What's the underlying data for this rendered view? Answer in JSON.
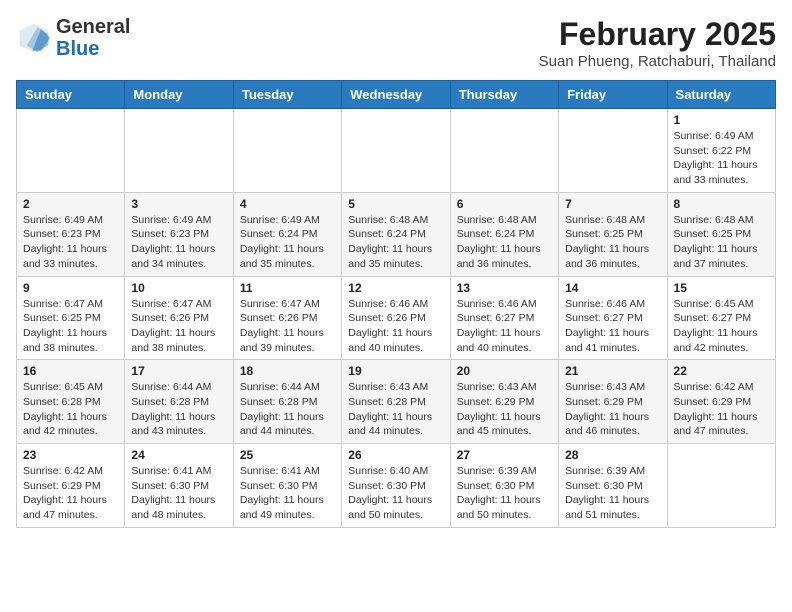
{
  "logo": {
    "general": "General",
    "blue": "Blue"
  },
  "header": {
    "month": "February 2025",
    "location": "Suan Phueng, Ratchaburi, Thailand"
  },
  "weekdays": [
    "Sunday",
    "Monday",
    "Tuesday",
    "Wednesday",
    "Thursday",
    "Friday",
    "Saturday"
  ],
  "weeks": [
    [
      null,
      null,
      null,
      null,
      null,
      null,
      {
        "day": "1",
        "info": "Sunrise: 6:49 AM\nSunset: 6:22 PM\nDaylight: 11 hours\nand 33 minutes."
      }
    ],
    [
      {
        "day": "2",
        "info": "Sunrise: 6:49 AM\nSunset: 6:23 PM\nDaylight: 11 hours\nand 33 minutes."
      },
      {
        "day": "3",
        "info": "Sunrise: 6:49 AM\nSunset: 6:23 PM\nDaylight: 11 hours\nand 34 minutes."
      },
      {
        "day": "4",
        "info": "Sunrise: 6:49 AM\nSunset: 6:24 PM\nDaylight: 11 hours\nand 35 minutes."
      },
      {
        "day": "5",
        "info": "Sunrise: 6:48 AM\nSunset: 6:24 PM\nDaylight: 11 hours\nand 35 minutes."
      },
      {
        "day": "6",
        "info": "Sunrise: 6:48 AM\nSunset: 6:24 PM\nDaylight: 11 hours\nand 36 minutes."
      },
      {
        "day": "7",
        "info": "Sunrise: 6:48 AM\nSunset: 6:25 PM\nDaylight: 11 hours\nand 36 minutes."
      },
      {
        "day": "8",
        "info": "Sunrise: 6:48 AM\nSunset: 6:25 PM\nDaylight: 11 hours\nand 37 minutes."
      }
    ],
    [
      {
        "day": "9",
        "info": "Sunrise: 6:47 AM\nSunset: 6:25 PM\nDaylight: 11 hours\nand 38 minutes."
      },
      {
        "day": "10",
        "info": "Sunrise: 6:47 AM\nSunset: 6:26 PM\nDaylight: 11 hours\nand 38 minutes."
      },
      {
        "day": "11",
        "info": "Sunrise: 6:47 AM\nSunset: 6:26 PM\nDaylight: 11 hours\nand 39 minutes."
      },
      {
        "day": "12",
        "info": "Sunrise: 6:46 AM\nSunset: 6:26 PM\nDaylight: 11 hours\nand 40 minutes."
      },
      {
        "day": "13",
        "info": "Sunrise: 6:46 AM\nSunset: 6:27 PM\nDaylight: 11 hours\nand 40 minutes."
      },
      {
        "day": "14",
        "info": "Sunrise: 6:46 AM\nSunset: 6:27 PM\nDaylight: 11 hours\nand 41 minutes."
      },
      {
        "day": "15",
        "info": "Sunrise: 6:45 AM\nSunset: 6:27 PM\nDaylight: 11 hours\nand 42 minutes."
      }
    ],
    [
      {
        "day": "16",
        "info": "Sunrise: 6:45 AM\nSunset: 6:28 PM\nDaylight: 11 hours\nand 42 minutes."
      },
      {
        "day": "17",
        "info": "Sunrise: 6:44 AM\nSunset: 6:28 PM\nDaylight: 11 hours\nand 43 minutes."
      },
      {
        "day": "18",
        "info": "Sunrise: 6:44 AM\nSunset: 6:28 PM\nDaylight: 11 hours\nand 44 minutes."
      },
      {
        "day": "19",
        "info": "Sunrise: 6:43 AM\nSunset: 6:28 PM\nDaylight: 11 hours\nand 44 minutes."
      },
      {
        "day": "20",
        "info": "Sunrise: 6:43 AM\nSunset: 6:29 PM\nDaylight: 11 hours\nand 45 minutes."
      },
      {
        "day": "21",
        "info": "Sunrise: 6:43 AM\nSunset: 6:29 PM\nDaylight: 11 hours\nand 46 minutes."
      },
      {
        "day": "22",
        "info": "Sunrise: 6:42 AM\nSunset: 6:29 PM\nDaylight: 11 hours\nand 47 minutes."
      }
    ],
    [
      {
        "day": "23",
        "info": "Sunrise: 6:42 AM\nSunset: 6:29 PM\nDaylight: 11 hours\nand 47 minutes."
      },
      {
        "day": "24",
        "info": "Sunrise: 6:41 AM\nSunset: 6:30 PM\nDaylight: 11 hours\nand 48 minutes."
      },
      {
        "day": "25",
        "info": "Sunrise: 6:41 AM\nSunset: 6:30 PM\nDaylight: 11 hours\nand 49 minutes."
      },
      {
        "day": "26",
        "info": "Sunrise: 6:40 AM\nSunset: 6:30 PM\nDaylight: 11 hours\nand 50 minutes."
      },
      {
        "day": "27",
        "info": "Sunrise: 6:39 AM\nSunset: 6:30 PM\nDaylight: 11 hours\nand 50 minutes."
      },
      {
        "day": "28",
        "info": "Sunrise: 6:39 AM\nSunset: 6:30 PM\nDaylight: 11 hours\nand 51 minutes."
      },
      null
    ]
  ]
}
